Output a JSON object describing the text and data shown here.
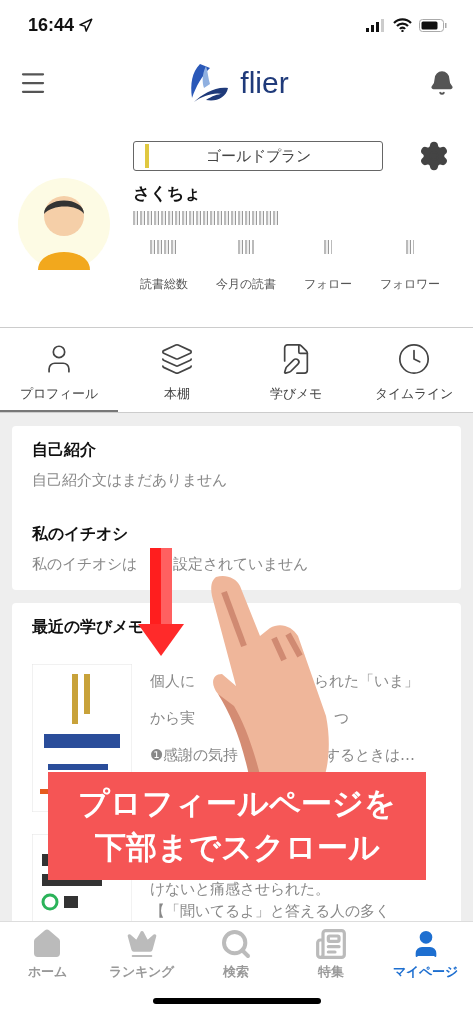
{
  "status_bar": {
    "time": "16:44"
  },
  "header": {
    "logo_text": "flier"
  },
  "profile": {
    "plan": "ゴールドプラン",
    "name": "さくちょ",
    "stats": [
      {
        "label": "読書総数"
      },
      {
        "label": "今月の読書"
      },
      {
        "label": "フォロー"
      },
      {
        "label": "フォロワー"
      }
    ]
  },
  "tabs": [
    {
      "label": "プロフィール",
      "selected": true
    },
    {
      "label": "本棚",
      "selected": false
    },
    {
      "label": "学びメモ",
      "selected": false
    },
    {
      "label": "タイムライン",
      "selected": false
    }
  ],
  "sections": [
    {
      "title": "自己紹介",
      "text": [
        "自己紹介文はまだありません"
      ]
    },
    {
      "title": "私のイチオシ",
      "text": [
        "私のイチオシは",
        "設定されていません"
      ]
    }
  ],
  "memos": {
    "title": "最近の学びメモ",
    "items": [
      {
        "kind": "picture",
        "lines": [
          [
            "個人に",
            "られた「いま」"
          ],
          [
            "から実",
            "つ"
          ],
          [
            "❶感謝の気持",
            "するときは…"
          ]
        ]
      },
      {
        "kind": "picture",
        "lines": [
          [
            "けないと痛感させられた。"
          ],
          [
            "【「聞いてるよ」と答える人の多く"
          ]
        ]
      }
    ]
  },
  "overlay": {
    "caption": [
      "プロフィールページを",
      "下部までスクロール"
    ]
  },
  "bottom_nav": [
    {
      "label": "ホーム",
      "selected": false
    },
    {
      "label": "ランキング",
      "selected": false
    },
    {
      "label": "検索",
      "selected": false
    },
    {
      "label": "特集",
      "selected": false
    },
    {
      "label": "マイページ",
      "selected": true
    }
  ]
}
